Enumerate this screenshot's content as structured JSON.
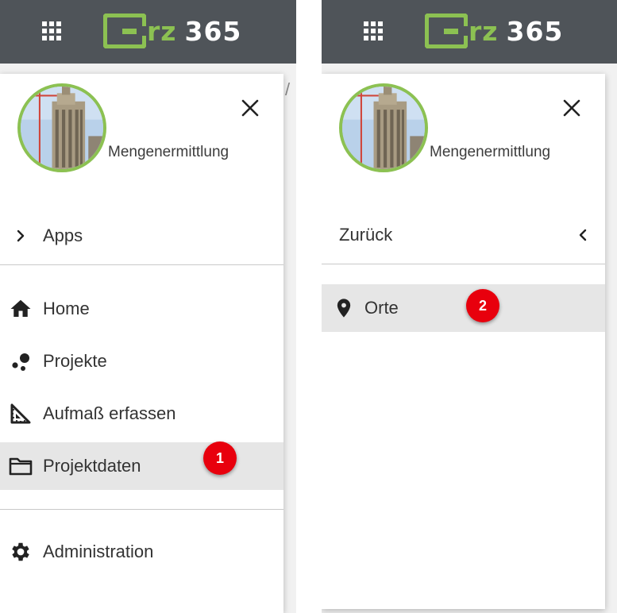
{
  "brand": {
    "name_prefix": "rz",
    "name_suffix": "365",
    "accent_color": "#8cc152",
    "header_color": "#4f5459",
    "badge_color": "#e8000d"
  },
  "left": {
    "app_name": "Mengenermittlung",
    "apps_label": "Apps",
    "menu": [
      {
        "label": "Home",
        "icon": "home-icon"
      },
      {
        "label": "Projekte",
        "icon": "projects-icon"
      },
      {
        "label": "Aufmaß erfassen",
        "icon": "measure-icon"
      },
      {
        "label": "Projektdaten",
        "icon": "folder-icon",
        "selected": true
      }
    ],
    "admin_label": "Administration",
    "badge": "1"
  },
  "right": {
    "app_name": "Mengenermittlung",
    "back_label": "Zurück",
    "menu": [
      {
        "label": "Orte",
        "icon": "location-pin-icon",
        "selected": true
      }
    ],
    "badge": "2"
  }
}
